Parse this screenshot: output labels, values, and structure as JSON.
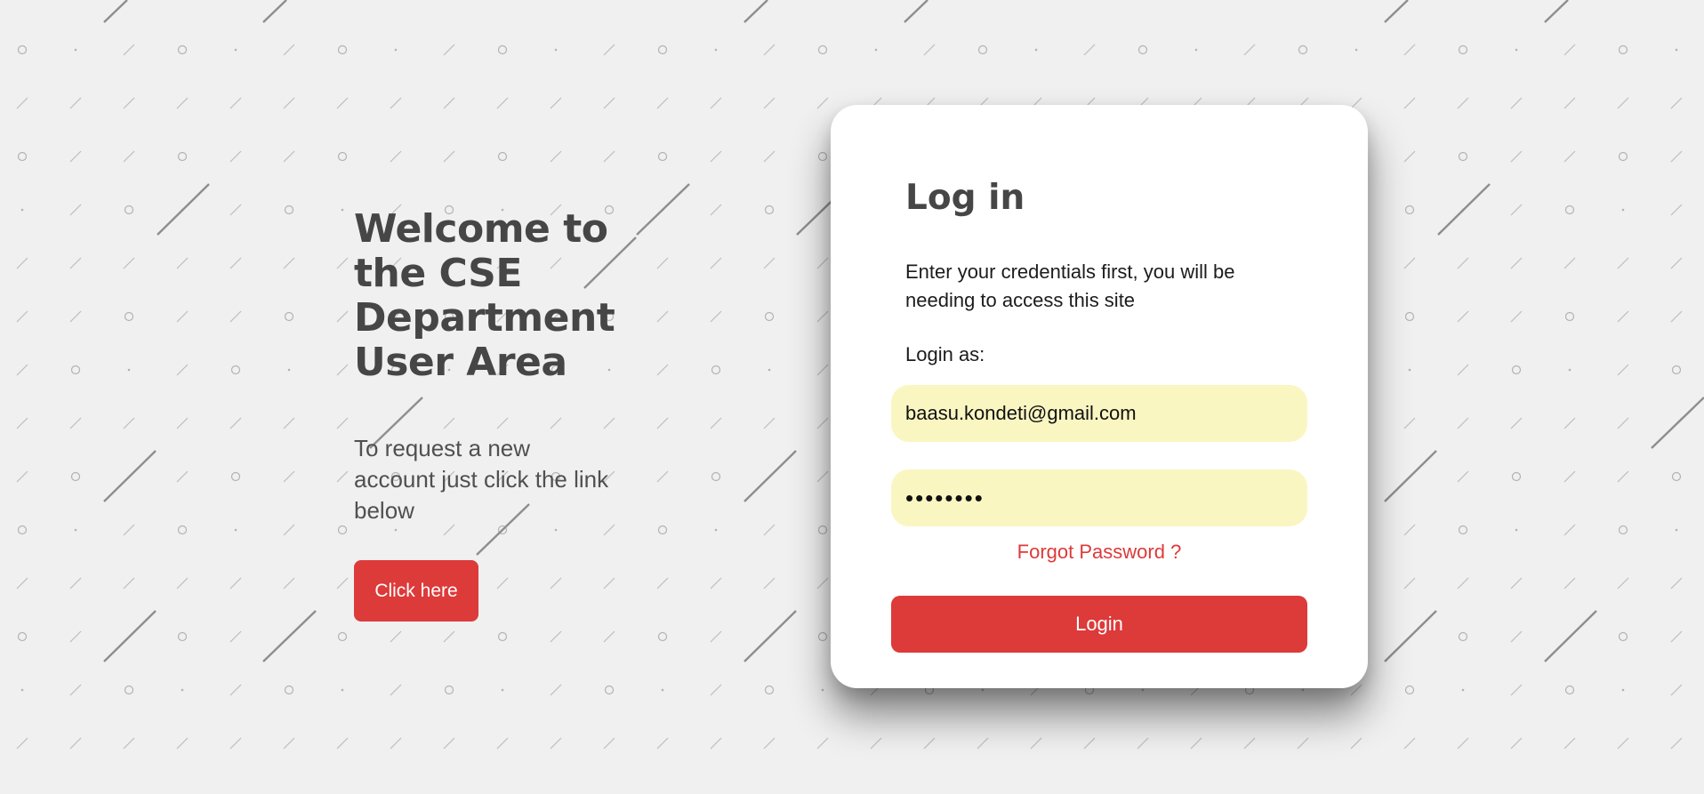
{
  "welcome": {
    "title": "Welcome to the CSE Department User Area",
    "subtitle": "To request a new account just click the link below",
    "cta_label": "Click here"
  },
  "login": {
    "title": "Log in",
    "description": "Enter your credentials first, you will be needing to access this site",
    "login_as_label": "Login as:",
    "email_value": "baasu.kondeti@gmail.com",
    "password_value": "••••••••",
    "forgot_label": "Forgot Password ?",
    "submit_label": "Login"
  },
  "colors": {
    "accent": "#dd3a3a",
    "page_background": "#f0f0f0",
    "card_background": "#ffffff",
    "field_background": "#faf6c2",
    "heading_text": "#464646"
  }
}
